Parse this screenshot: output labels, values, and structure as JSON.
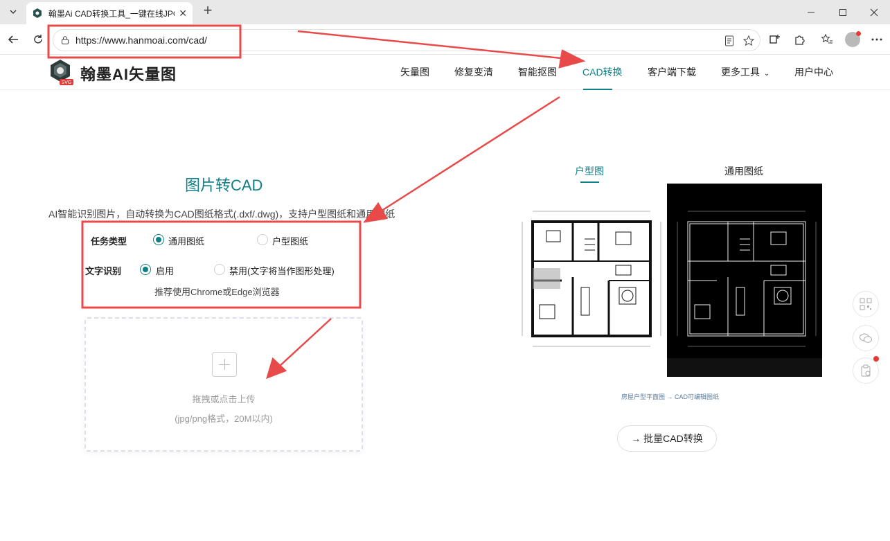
{
  "browser": {
    "tab_title": "翰墨Ai CAD转换工具_一键在线JPG",
    "url": "https://www.hanmoai.com/cad/"
  },
  "site": {
    "logo_text": "翰墨AI矢量图",
    "logo_badge": "SVG",
    "nav": [
      {
        "label": "矢量图"
      },
      {
        "label": "修复变清"
      },
      {
        "label": "智能抠图"
      },
      {
        "label": "CAD转换"
      },
      {
        "label": "客户端下载"
      },
      {
        "label": "更多工具"
      },
      {
        "label": "用户中心"
      }
    ],
    "active_nav": "CAD转换"
  },
  "main": {
    "title": "图片转CAD",
    "subtitle": "AI智能识别图片，自动转换为CAD图纸格式(.dxf/.dwg)，支持户型图纸和通用图纸",
    "task_label": "任务类型",
    "task_options": [
      "通用图纸",
      "户型图纸"
    ],
    "task_selected": "通用图纸",
    "ocr_label": "文字识别",
    "ocr_options": [
      "启用",
      "禁用(文字将当作图形处理)"
    ],
    "ocr_selected": "启用",
    "tip": "推荐使用Chrome或Edge浏览器",
    "upload_text": "拖拽或点击上传",
    "upload_hint": "(jpg/png格式，20M以内)"
  },
  "sample": {
    "tabs": [
      "户型图",
      "通用图纸"
    ],
    "active_tab": "户型图",
    "caption": "房屋户型平面图 → CAD可编辑图纸",
    "batch_button": "→ 批量CAD转换"
  },
  "colors": {
    "accent": "#0f7f88",
    "annotation_red": "#e84a4a"
  }
}
